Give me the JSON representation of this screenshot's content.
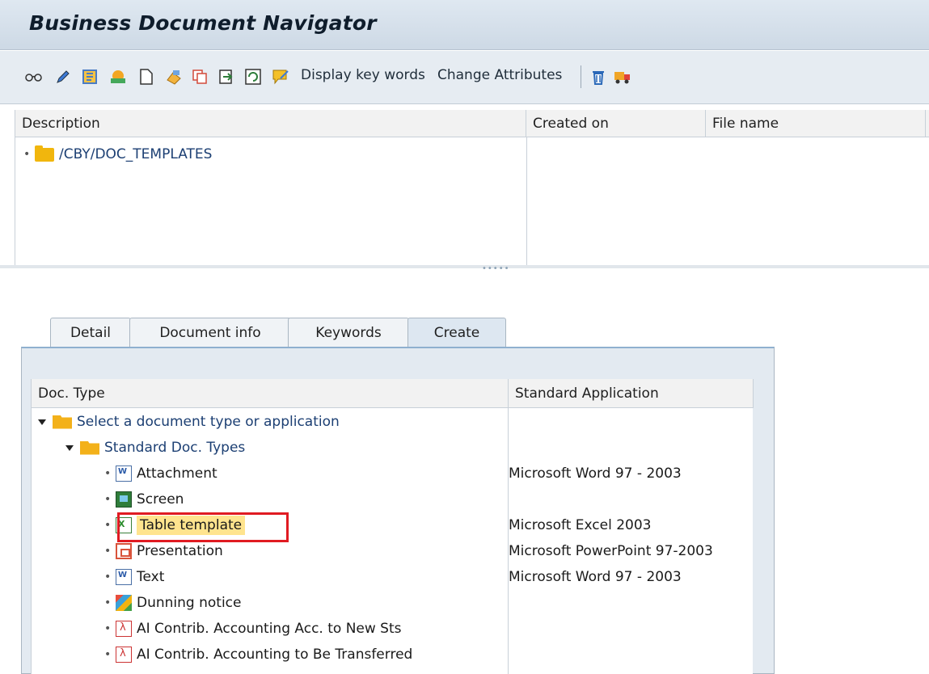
{
  "window": {
    "title": "Business Document Navigator"
  },
  "toolbar": {
    "icons": [
      "glasses-icon",
      "pencil-icon",
      "keyword-icon",
      "chart-icon",
      "new-document-icon",
      "edit-document-icon",
      "copy-icon",
      "export-icon",
      "refresh-icon",
      "comment-icon"
    ],
    "display_key_words": "Display key words",
    "change_attributes": "Change Attributes",
    "delete_icon": "trash-icon",
    "transport_icon": "truck-icon"
  },
  "top_table": {
    "columns": [
      "Description",
      "Created on",
      "File name"
    ],
    "rows": [
      {
        "label": "/CBY/DOC_TEMPLATES"
      }
    ]
  },
  "tabs": [
    {
      "label": "Detail"
    },
    {
      "label": "Document info"
    },
    {
      "label": "Keywords"
    },
    {
      "label": "Create",
      "active": true
    }
  ],
  "create_table": {
    "columns": [
      "Doc. Type",
      "Standard Application"
    ],
    "rows": [
      {
        "label": "Select a document type or application",
        "app": ""
      },
      {
        "label": "Standard Doc. Types",
        "app": ""
      },
      {
        "label": "Attachment",
        "app": "Microsoft Word 97 - 2003"
      },
      {
        "label": "Screen",
        "app": ""
      },
      {
        "label": "Table template",
        "app": "Microsoft Excel 2003"
      },
      {
        "label": "Presentation",
        "app": "Microsoft PowerPoint 97-2003"
      },
      {
        "label": "Text",
        "app": "Microsoft Word 97 - 2003"
      },
      {
        "label": "Dunning notice",
        "app": ""
      },
      {
        "label": "AI Contrib. Accounting Acc. to New Sts",
        "app": ""
      },
      {
        "label": "AI Contrib. Accounting to Be Transferred",
        "app": ""
      }
    ]
  },
  "colors": {
    "highlight": "#ffe48e",
    "focus_box": "#e01b22",
    "link": "#1c3f73"
  }
}
